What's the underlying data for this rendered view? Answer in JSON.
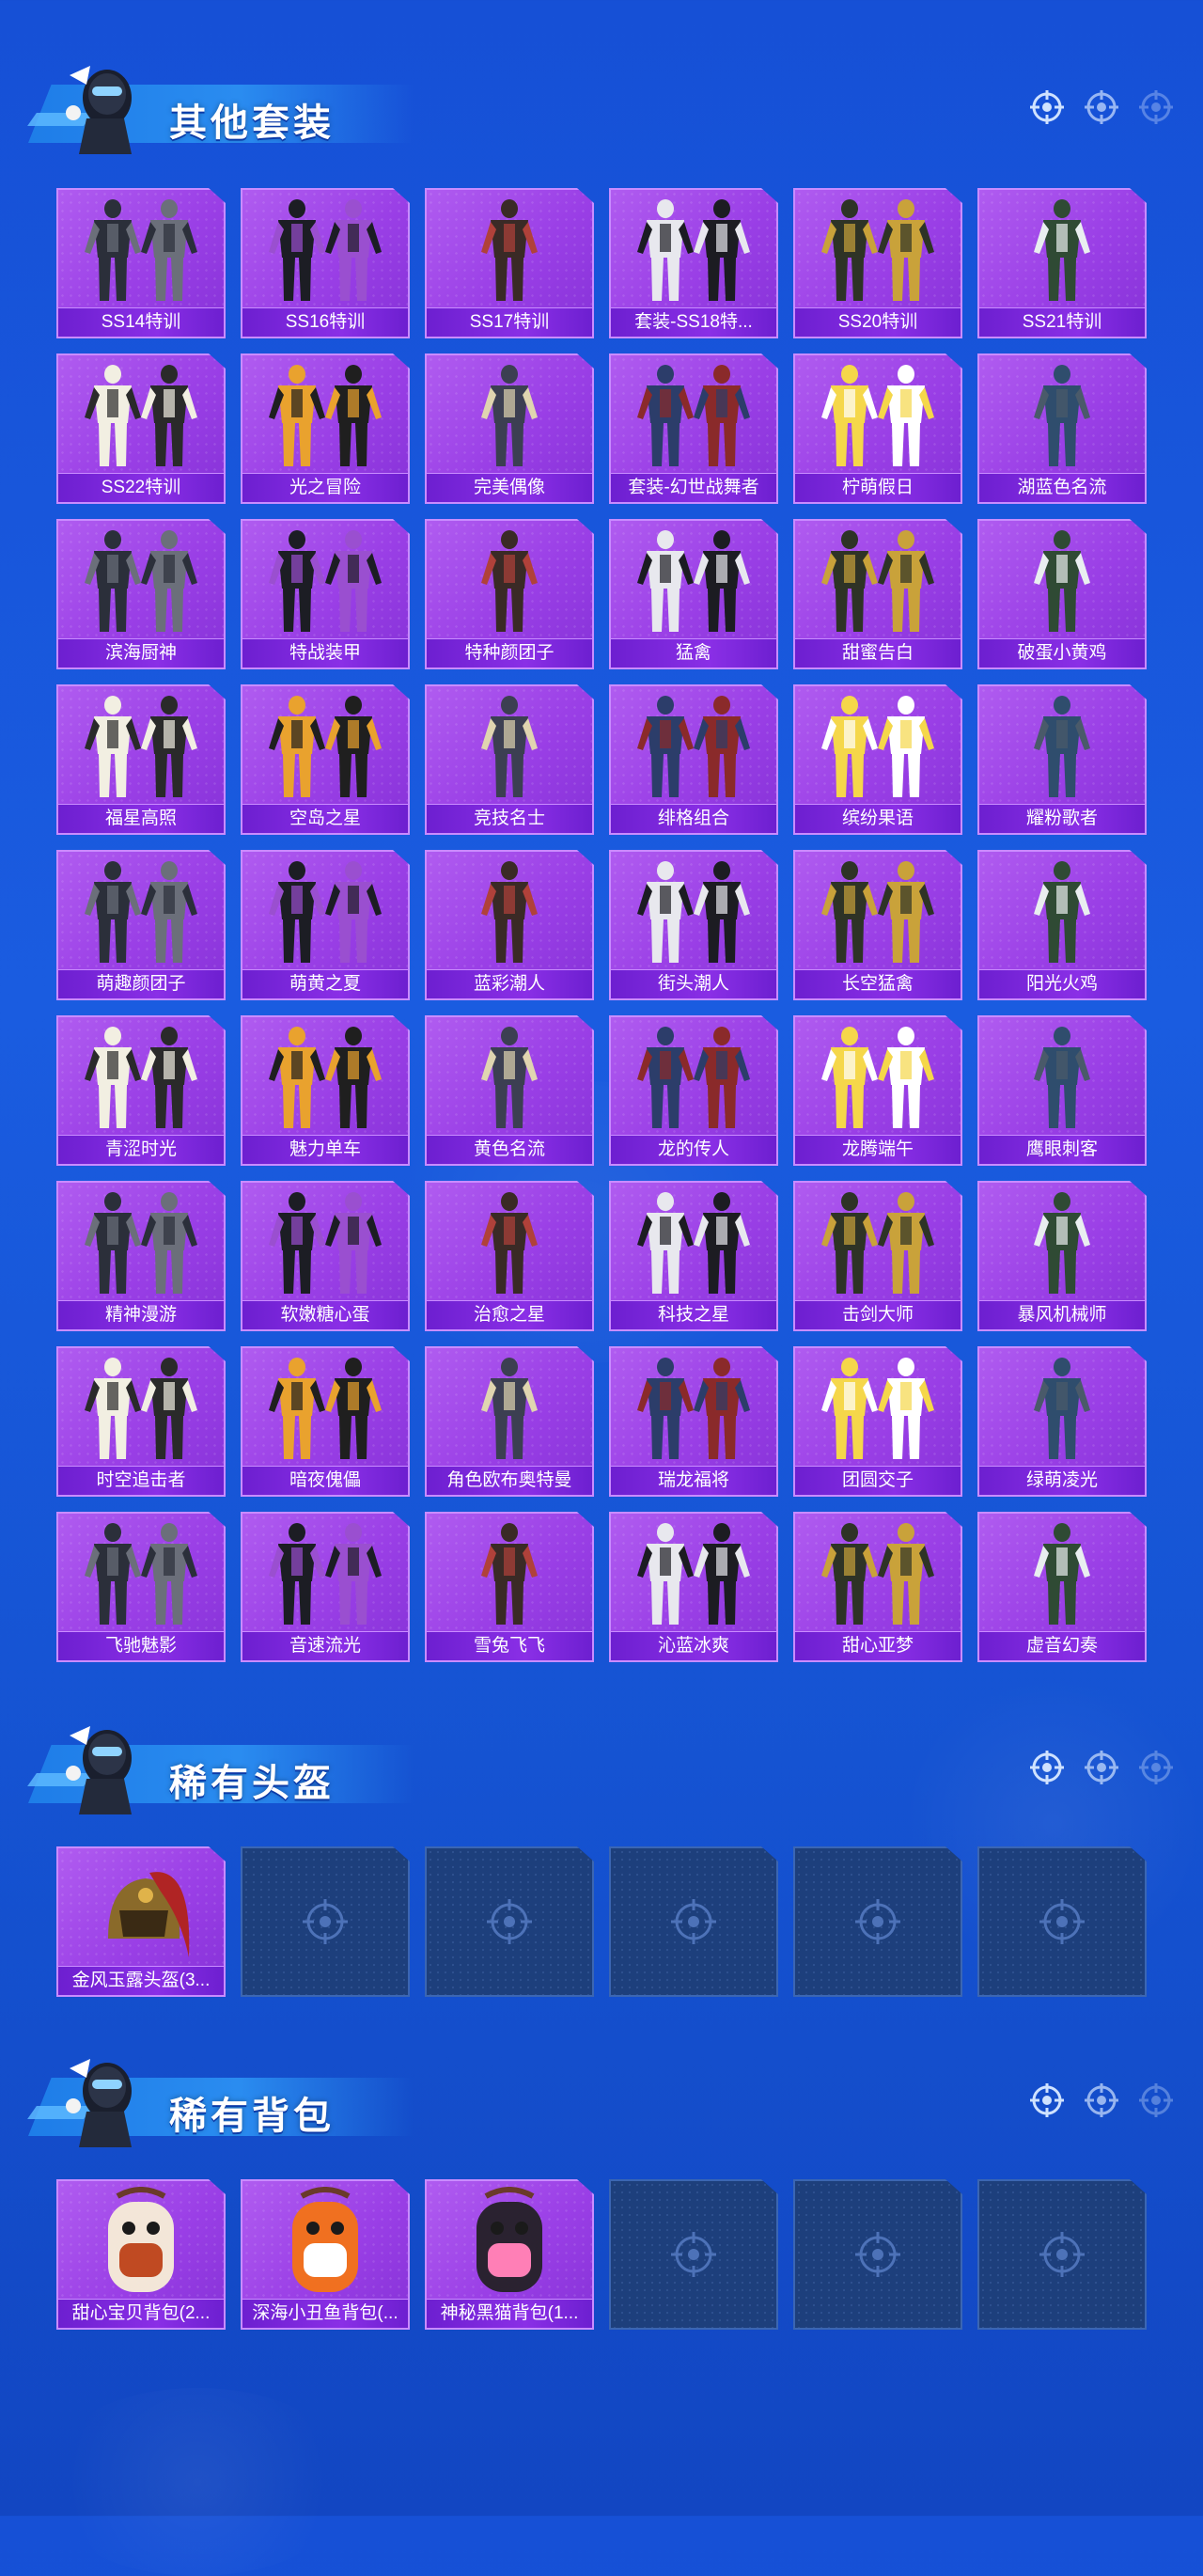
{
  "sections": [
    {
      "title": "其他套装",
      "items": [
        {
          "label": "SS14特训"
        },
        {
          "label": "SS16特训"
        },
        {
          "label": "SS17特训"
        },
        {
          "label": "套装-SS18特..."
        },
        {
          "label": "SS20特训"
        },
        {
          "label": "SS21特训"
        },
        {
          "label": "SS22特训"
        },
        {
          "label": "光之冒险"
        },
        {
          "label": "完美偶像"
        },
        {
          "label": "套装-幻世战舞者"
        },
        {
          "label": "柠萌假日"
        },
        {
          "label": "湖蓝色名流"
        },
        {
          "label": "滨海厨神"
        },
        {
          "label": "特战装甲"
        },
        {
          "label": "特种颜团子"
        },
        {
          "label": "猛禽"
        },
        {
          "label": "甜蜜告白"
        },
        {
          "label": "破蛋小黄鸡"
        },
        {
          "label": "福星高照"
        },
        {
          "label": "空岛之星"
        },
        {
          "label": "竞技名士"
        },
        {
          "label": "绯格组合"
        },
        {
          "label": "缤纷果语"
        },
        {
          "label": "耀粉歌者"
        },
        {
          "label": "萌趣颜团子"
        },
        {
          "label": "萌黄之夏"
        },
        {
          "label": "蓝彩潮人"
        },
        {
          "label": "街头潮人"
        },
        {
          "label": "长空猛禽"
        },
        {
          "label": "阳光火鸡"
        },
        {
          "label": "青涩时光"
        },
        {
          "label": "魅力单车"
        },
        {
          "label": "黄色名流"
        },
        {
          "label": "龙的传人"
        },
        {
          "label": "龙腾端午"
        },
        {
          "label": "鹰眼刺客"
        },
        {
          "label": "精神漫游"
        },
        {
          "label": "软嫩糖心蛋"
        },
        {
          "label": "治愈之星"
        },
        {
          "label": "科技之星"
        },
        {
          "label": "击剑大师"
        },
        {
          "label": "暴风机械师"
        },
        {
          "label": "时空追击者"
        },
        {
          "label": "暗夜傀儡"
        },
        {
          "label": "角色欧布奥特曼"
        },
        {
          "label": "瑞龙福将"
        },
        {
          "label": "团圆交子"
        },
        {
          "label": "绿萌凌光"
        },
        {
          "label": "飞驰魅影"
        },
        {
          "label": "音速流光"
        },
        {
          "label": "雪兔飞飞"
        },
        {
          "label": "沁蓝冰爽"
        },
        {
          "label": "甜心亚梦"
        },
        {
          "label": "虚音幻奏"
        }
      ],
      "empty_slots": 0
    },
    {
      "title": "稀有头盔",
      "items": [
        {
          "label": "金风玉露头盔(3..."
        }
      ],
      "empty_slots": 5
    },
    {
      "title": "稀有背包",
      "items": [
        {
          "label": "甜心宝贝背包(2..."
        },
        {
          "label": "深海小丑鱼背包(..."
        },
        {
          "label": "神秘黑猫背包(1..."
        }
      ],
      "empty_slots": 3
    }
  ],
  "colors": {
    "background": "#1a5ce0",
    "card_purple": "#9a3fe6",
    "label_bar": "#7a26dc",
    "empty_slot": "#1d3f7c",
    "ribbon": "#2a8cf0"
  },
  "icons": {
    "header_targets": "crosshair-icon",
    "empty_slot": "crosshair-icon",
    "mascot": "mascot-icon"
  }
}
